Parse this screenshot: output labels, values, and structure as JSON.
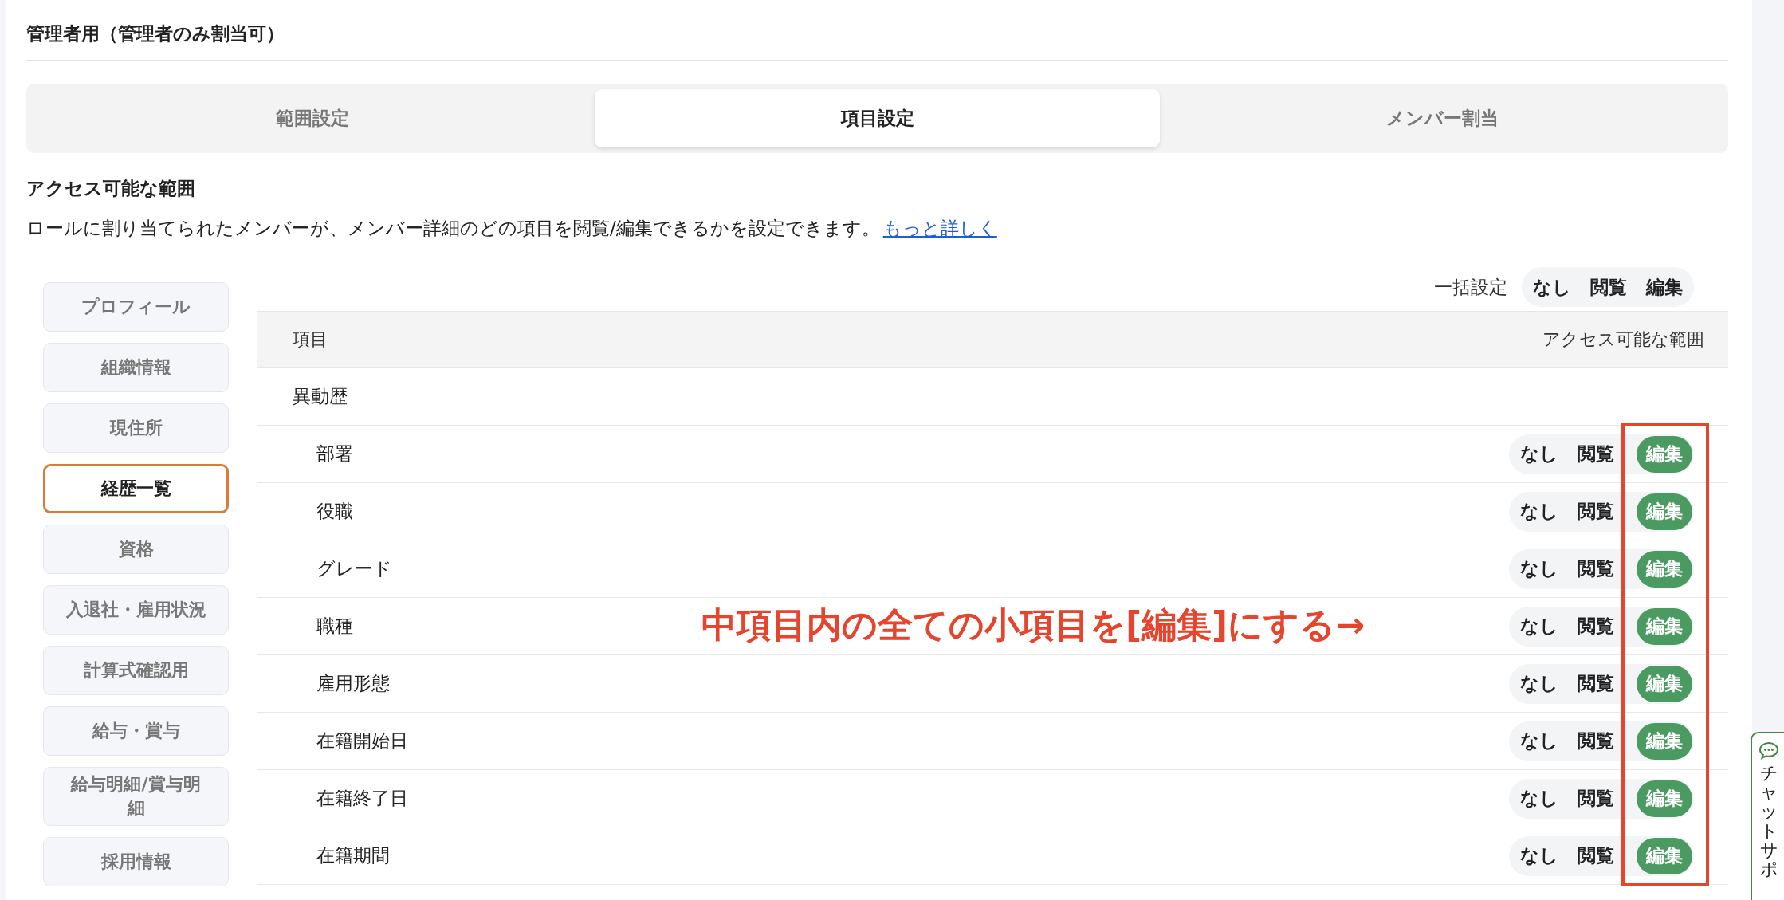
{
  "page_title": "管理者用（管理者のみ割当可）",
  "tabs": [
    {
      "label": "範囲設定",
      "selected": false
    },
    {
      "label": "項目設定",
      "selected": true
    },
    {
      "label": "メンバー割当",
      "selected": false
    }
  ],
  "section": {
    "title": "アクセス可能な範囲",
    "description": "ロールに割り当てられたメンバーが、メンバー詳細のどの項目を閲覧/編集できるかを設定できます。",
    "link": "もっと詳しく"
  },
  "categories": [
    {
      "label": "プロフィール",
      "selected": false
    },
    {
      "label": "組織情報",
      "selected": false
    },
    {
      "label": "現住所",
      "selected": false
    },
    {
      "label": "経歴一覧",
      "selected": true
    },
    {
      "label": "資格",
      "selected": false
    },
    {
      "label": "入退社・雇用状況",
      "selected": false
    },
    {
      "label": "計算式確認用",
      "selected": false
    },
    {
      "label": "給与・賞与",
      "selected": false
    },
    {
      "label": "給与明細/賞与明細",
      "selected": false
    },
    {
      "label": "採用情報",
      "selected": false
    }
  ],
  "bulk": {
    "label": "一括設定",
    "options": [
      "なし",
      "閲覧",
      "編集"
    ]
  },
  "table": {
    "columns": [
      "項目",
      "アクセス可能な範囲"
    ],
    "group": "異動歴",
    "rows": [
      {
        "name": "部署",
        "options": [
          {
            "label": "なし",
            "selected": false
          },
          {
            "label": "閲覧",
            "selected": false
          },
          {
            "label": "編集",
            "selected": true
          }
        ]
      },
      {
        "name": "役職",
        "options": [
          {
            "label": "なし",
            "selected": false
          },
          {
            "label": "閲覧",
            "selected": false
          },
          {
            "label": "編集",
            "selected": true
          }
        ]
      },
      {
        "name": "グレード",
        "options": [
          {
            "label": "なし",
            "selected": false
          },
          {
            "label": "閲覧",
            "selected": false
          },
          {
            "label": "編集",
            "selected": true
          }
        ]
      },
      {
        "name": "職種",
        "options": [
          {
            "label": "なし",
            "selected": false
          },
          {
            "label": "閲覧",
            "selected": false
          },
          {
            "label": "編集",
            "selected": true
          }
        ]
      },
      {
        "name": "雇用形態",
        "options": [
          {
            "label": "なし",
            "selected": false
          },
          {
            "label": "閲覧",
            "selected": false
          },
          {
            "label": "編集",
            "selected": true
          }
        ]
      },
      {
        "name": "在籍開始日",
        "options": [
          {
            "label": "なし",
            "selected": false
          },
          {
            "label": "閲覧",
            "selected": false
          },
          {
            "label": "編集",
            "selected": true
          }
        ]
      },
      {
        "name": "在籍終了日",
        "options": [
          {
            "label": "なし",
            "selected": false
          },
          {
            "label": "閲覧",
            "selected": false
          },
          {
            "label": "編集",
            "selected": true
          }
        ]
      },
      {
        "name": "在籍期間",
        "options": [
          {
            "label": "なし",
            "selected": false
          },
          {
            "label": "閲覧",
            "selected": false
          },
          {
            "label": "編集",
            "selected": true
          }
        ]
      }
    ]
  },
  "annotation": {
    "text": "中項目内の全ての小項目を[編集]にする→"
  },
  "chat": {
    "label": "チャットサポ"
  }
}
